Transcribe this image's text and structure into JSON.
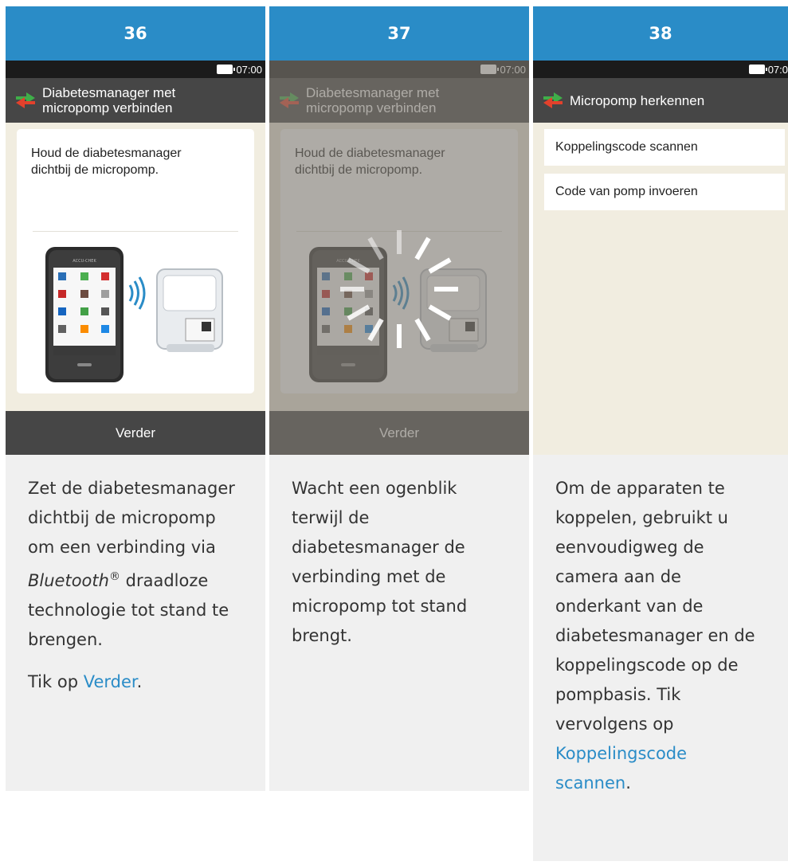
{
  "colors": {
    "header_blue": "#2a8cc7",
    "screen_bg": "#f1ede0",
    "bar_dark": "#464646",
    "link": "#2a8cc7"
  },
  "steps": [
    {
      "number": "36",
      "time": "07:00",
      "title_line1": "Diabetesmanager met",
      "title_line2": "micropomp verbinden",
      "card_text_line1": "Houd de diabetesmanager",
      "card_text_line2": "dichtbij de micropomp.",
      "button": "Verder",
      "desc_a": "Zet de diabetesmanager dichtbij de micropomp om een verbinding via ",
      "desc_b": "Bluetooth",
      "desc_reg": "®",
      "desc_c": " draadloze technologie tot stand te brengen.",
      "tap_prefix": "Tik op ",
      "tap_link": "Verder",
      "tap_suffix": "."
    },
    {
      "number": "37",
      "time": "07:00",
      "title_line1": "Diabetesmanager met",
      "title_line2": "micropomp verbinden",
      "card_text_line1": "Houd de diabetesmanager",
      "card_text_line2": "dichtbij de micropomp.",
      "button": "Verder",
      "desc": "Wacht een ogenblik terwijl de diabetesmanager de verbinding met de micropomp tot stand brengt."
    },
    {
      "number": "38",
      "time": "07:0",
      "title": "Micropomp herkennen",
      "menu": [
        "Koppelingscode scannen",
        "Code van pomp invoeren"
      ],
      "desc_a": "Om de apparaten te koppelen, gebruikt u eenvoudigweg de camera aan de onderkant van de diabetesmanager en de koppelingscode op de pompbasis. Tik vervolgens op ",
      "desc_link": "Koppelingscode scannen",
      "desc_suffix": "."
    }
  ],
  "icons": [
    "sync-arrows-icon",
    "battery-icon",
    "loading-spinner-icon",
    "bluetooth-waves-icon"
  ]
}
